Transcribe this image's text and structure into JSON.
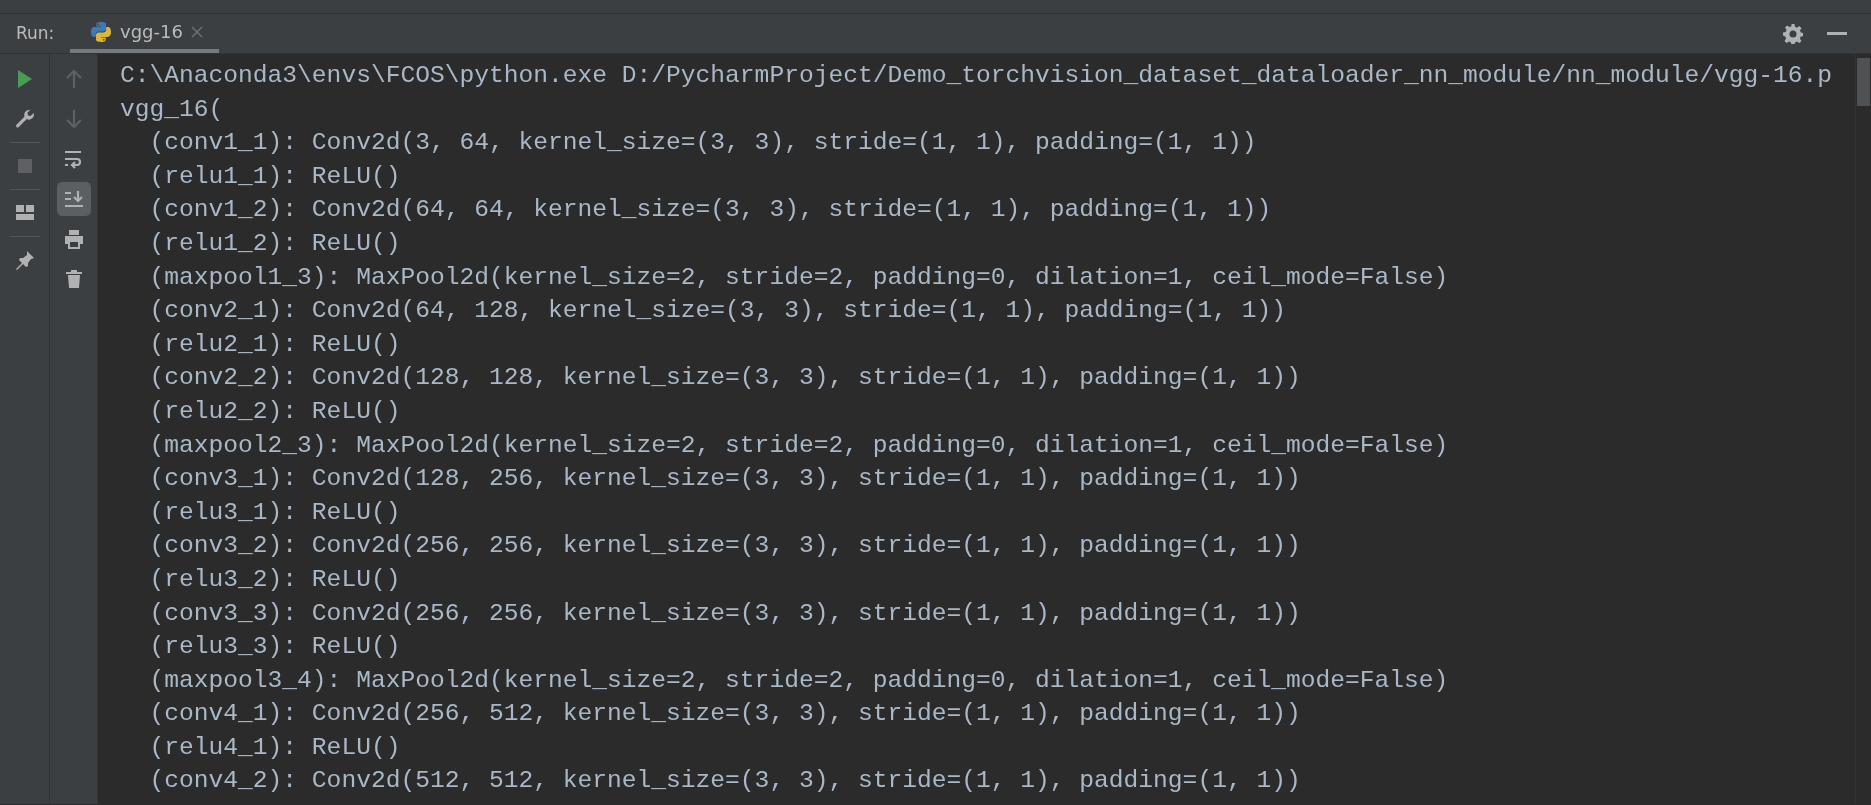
{
  "run_panel": {
    "label": "Run:",
    "tabs": [
      {
        "label": "vgg-16",
        "selected": true
      }
    ]
  },
  "toolbar_left": [
    {
      "kind": "run",
      "disabled": false
    },
    {
      "kind": "wrench",
      "disabled": false
    },
    {
      "kind": "stop",
      "disabled": true
    },
    {
      "kind": "layout",
      "disabled": false
    },
    {
      "kind": "pin",
      "disabled": false
    }
  ],
  "toolbar_right": [
    {
      "kind": "up",
      "disabled": true,
      "on": false
    },
    {
      "kind": "down",
      "disabled": true,
      "on": false
    },
    {
      "kind": "wrap",
      "disabled": false,
      "on": false
    },
    {
      "kind": "scroll-end",
      "disabled": false,
      "on": true
    },
    {
      "kind": "print",
      "disabled": false,
      "on": false
    },
    {
      "kind": "trash",
      "disabled": false,
      "on": false
    }
  ],
  "console": {
    "lines": [
      "C:\\Anaconda3\\envs\\FCOS\\python.exe D:/PycharmProject/Demo_torchvision_dataset_dataloader_nn_module/nn_module/vgg-16.p",
      "vgg_16(",
      "  (conv1_1): Conv2d(3, 64, kernel_size=(3, 3), stride=(1, 1), padding=(1, 1))",
      "  (relu1_1): ReLU()",
      "  (conv1_2): Conv2d(64, 64, kernel_size=(3, 3), stride=(1, 1), padding=(1, 1))",
      "  (relu1_2): ReLU()",
      "  (maxpool1_3): MaxPool2d(kernel_size=2, stride=2, padding=0, dilation=1, ceil_mode=False)",
      "  (conv2_1): Conv2d(64, 128, kernel_size=(3, 3), stride=(1, 1), padding=(1, 1))",
      "  (relu2_1): ReLU()",
      "  (conv2_2): Conv2d(128, 128, kernel_size=(3, 3), stride=(1, 1), padding=(1, 1))",
      "  (relu2_2): ReLU()",
      "  (maxpool2_3): MaxPool2d(kernel_size=2, stride=2, padding=0, dilation=1, ceil_mode=False)",
      "  (conv3_1): Conv2d(128, 256, kernel_size=(3, 3), stride=(1, 1), padding=(1, 1))",
      "  (relu3_1): ReLU()",
      "  (conv3_2): Conv2d(256, 256, kernel_size=(3, 3), stride=(1, 1), padding=(1, 1))",
      "  (relu3_2): ReLU()",
      "  (conv3_3): Conv2d(256, 256, kernel_size=(3, 3), stride=(1, 1), padding=(1, 1))",
      "  (relu3_3): ReLU()",
      "  (maxpool3_4): MaxPool2d(kernel_size=2, stride=2, padding=0, dilation=1, ceil_mode=False)",
      "  (conv4_1): Conv2d(256, 512, kernel_size=(3, 3), stride=(1, 1), padding=(1, 1))",
      "  (relu4_1): ReLU()",
      "  (conv4_2): Conv2d(512, 512, kernel_size=(3, 3), stride=(1, 1), padding=(1, 1))"
    ]
  }
}
